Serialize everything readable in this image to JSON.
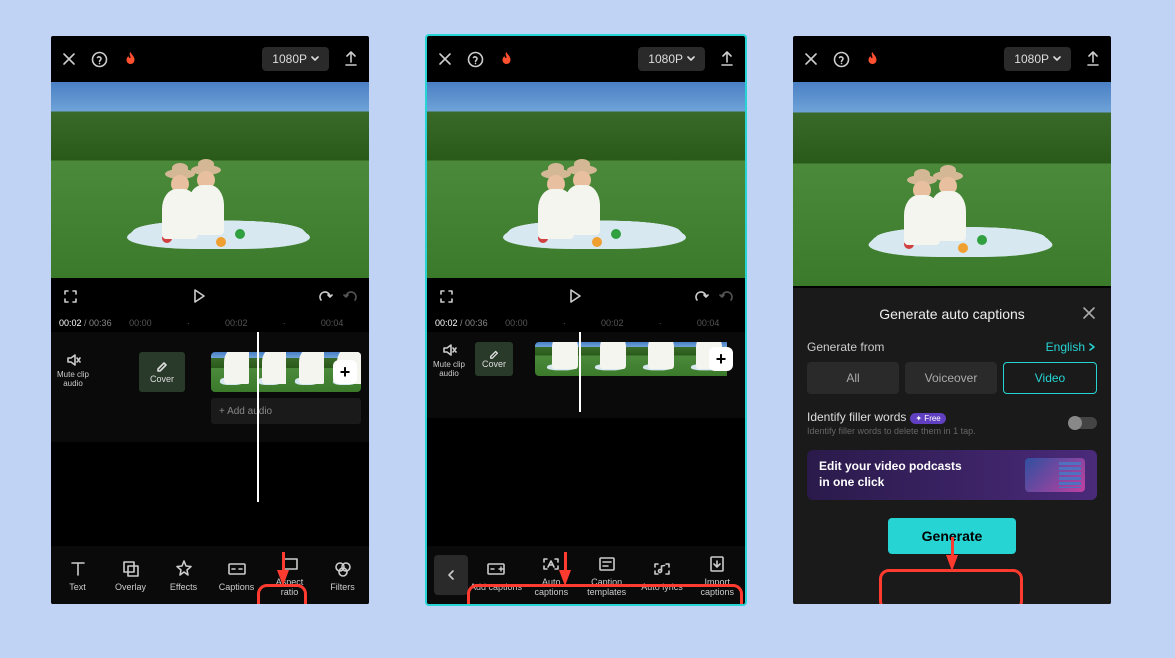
{
  "topbar": {
    "resolution": "1080P"
  },
  "controls": {
    "current_time": "00:02",
    "total_time": "00:36"
  },
  "timeline": {
    "marks": [
      "00:00",
      "00:02",
      "00:04"
    ],
    "cover_label": "Cover",
    "mute_label": "Mute clip audio",
    "add_audio_label": "+ Add audio",
    "add_clip": "+"
  },
  "toolbar1": [
    {
      "key": "text",
      "label": "Text"
    },
    {
      "key": "overlay",
      "label": "Overlay"
    },
    {
      "key": "effects",
      "label": "Effects"
    },
    {
      "key": "captions",
      "label": "Captions"
    },
    {
      "key": "aspect",
      "label": "Aspect ratio"
    },
    {
      "key": "filters",
      "label": "Filters"
    }
  ],
  "toolbar2": [
    {
      "key": "add-captions",
      "label": "Add captions"
    },
    {
      "key": "auto-captions",
      "label": "Auto captions"
    },
    {
      "key": "caption-templates",
      "label": "Caption templates"
    },
    {
      "key": "auto-lyrics",
      "label": "Auto lyrics"
    },
    {
      "key": "import-captions",
      "label": "Import captions"
    }
  ],
  "sheet": {
    "title": "Generate auto captions",
    "from_label": "Generate from",
    "language": "English",
    "sources": [
      "All",
      "Voiceover",
      "Video"
    ],
    "selected_source": "Video",
    "filler_title": "Identify filler words",
    "filler_badge": "✦ Free",
    "filler_sub": "Identify filler words to delete them in 1 tap.",
    "promo_line1": "Edit your video podcasts",
    "promo_line2": "in one click",
    "generate_btn": "Generate"
  }
}
